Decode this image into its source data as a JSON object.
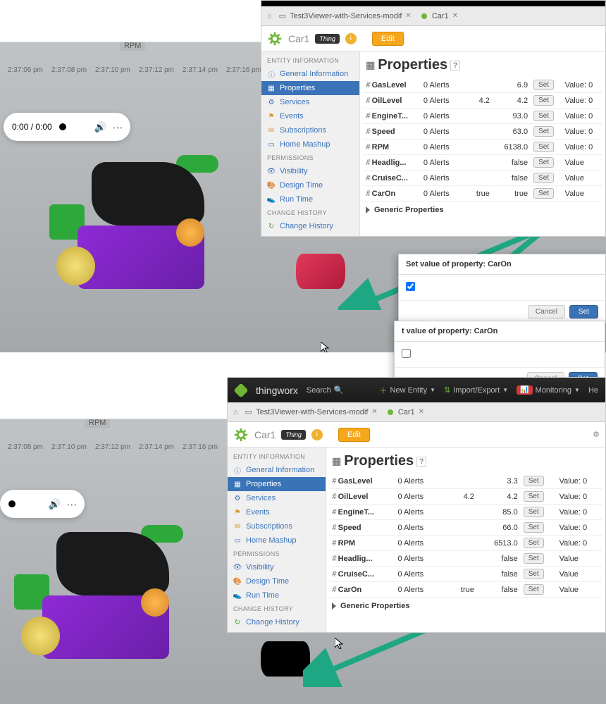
{
  "upper": {
    "home_title": "Home",
    "rpm_label": "RPM",
    "timeline": [
      "2:37:06 pm",
      "2:37:08 pm",
      "2:37:10 pm",
      "2:37:12 pm",
      "2:37:14 pm",
      "2:37:16 pm"
    ],
    "media_time": "0:00 / 0:00",
    "panel": {
      "tabs": [
        {
          "icon": "doc",
          "label": "Test3Viewer-with-Services-modif"
        },
        {
          "icon": "car",
          "label": "Car1"
        }
      ],
      "entity_name": "Car1",
      "thing_label": "Thing",
      "edit_label": "Edit",
      "main_title": "Properties",
      "side_head1": "ENTITY INFORMATION",
      "side_items1": [
        {
          "ico": "ℹ",
          "label": "General Information"
        },
        {
          "ico": "▦",
          "label": "Properties",
          "active": true
        },
        {
          "ico": "⚙",
          "label": "Services"
        },
        {
          "ico": "⚑",
          "label": "Events"
        },
        {
          "ico": "✉",
          "label": "Subscriptions"
        },
        {
          "ico": "⌂",
          "label": "Home Mashup"
        }
      ],
      "side_head2": "PERMISSIONS",
      "side_items2": [
        {
          "ico": "👁",
          "label": "Visibility"
        },
        {
          "ico": "🎨",
          "label": "Design Time"
        },
        {
          "ico": "👟",
          "label": "Run Time"
        }
      ],
      "side_head3": "CHANGE HISTORY",
      "side_items3": [
        {
          "ico": "↻",
          "label": "Change History"
        }
      ],
      "props": [
        {
          "name": "GasLevel",
          "alerts": "0 Alerts",
          "c3": "",
          "c4": "6.9",
          "set": "Set",
          "val": "Value: 0"
        },
        {
          "name": "OilLevel",
          "alerts": "0 Alerts",
          "c3": "4.2",
          "c4": "4.2",
          "set": "Set",
          "val": "Value: 0"
        },
        {
          "name": "EngineT...",
          "alerts": "0 Alerts",
          "c3": "",
          "c4": "93.0",
          "set": "Set",
          "val": "Value: 0"
        },
        {
          "name": "Speed",
          "alerts": "0 Alerts",
          "c3": "",
          "c4": "63.0",
          "set": "Set",
          "val": "Value: 0"
        },
        {
          "name": "RPM",
          "alerts": "0 Alerts",
          "c3": "",
          "c4": "6138.0",
          "set": "Set",
          "val": "Value: 0"
        },
        {
          "name": "Headlig...",
          "alerts": "0 Alerts",
          "c3": "",
          "c4": "false",
          "set": "Set",
          "val": "Value"
        },
        {
          "name": "CruiseC...",
          "alerts": "0 Alerts",
          "c3": "",
          "c4": "false",
          "set": "Set",
          "val": "Value"
        },
        {
          "name": "CarOn",
          "alerts": "0 Alerts",
          "c3": "true",
          "c4": "true",
          "set": "Set",
          "val": "Value"
        }
      ],
      "generic": "Generic Properties"
    },
    "popup1": {
      "title": "Set value of property: CarOn",
      "checked": true,
      "cancel": "Cancel",
      "set": "Set"
    },
    "popup2": {
      "title": "t value of property: CarOn",
      "checked": false,
      "cancel": "Cancel",
      "set": "Set"
    }
  },
  "lower": {
    "topbar": {
      "brand": "thingworx",
      "search": "Search",
      "new_entity": "New Entity",
      "import": "Import/Export",
      "monitoring": "Monitoring",
      "help": "He"
    },
    "home_title": "Home",
    "rpm_label": "RPM",
    "timeline": [
      "2:37:08 pm",
      "2:37:10 pm",
      "2:37:12 pm",
      "2:37:14 pm",
      "2:37:16 pm"
    ],
    "panel": {
      "tabs": [
        {
          "icon": "doc",
          "label": "Test3Viewer-with-Services-modif"
        },
        {
          "icon": "car",
          "label": "Car1"
        }
      ],
      "entity_name": "Car1",
      "thing_label": "Thing",
      "edit_label": "Edit",
      "main_title": "Properties",
      "side_head1": "ENTITY INFORMATION",
      "side_items1": [
        {
          "ico": "ℹ",
          "label": "General Information"
        },
        {
          "ico": "▦",
          "label": "Properties",
          "active": true
        },
        {
          "ico": "⚙",
          "label": "Services"
        },
        {
          "ico": "⚑",
          "label": "Events"
        },
        {
          "ico": "✉",
          "label": "Subscriptions"
        },
        {
          "ico": "⌂",
          "label": "Home Mashup"
        }
      ],
      "side_head2": "PERMISSIONS",
      "side_items2": [
        {
          "ico": "👁",
          "label": "Visibility"
        },
        {
          "ico": "🎨",
          "label": "Design Time"
        },
        {
          "ico": "👟",
          "label": "Run Time"
        }
      ],
      "side_head3": "CHANGE HISTORY",
      "side_items3": [
        {
          "ico": "↻",
          "label": "Change History"
        }
      ],
      "props": [
        {
          "name": "GasLevel",
          "alerts": "0 Alerts",
          "c3": "",
          "c4": "3.3",
          "set": "Set",
          "val": "Value: 0"
        },
        {
          "name": "OilLevel",
          "alerts": "0 Alerts",
          "c3": "4.2",
          "c4": "4.2",
          "set": "Set",
          "val": "Value: 0"
        },
        {
          "name": "EngineT...",
          "alerts": "0 Alerts",
          "c3": "",
          "c4": "85.0",
          "set": "Set",
          "val": "Value: 0"
        },
        {
          "name": "Speed",
          "alerts": "0 Alerts",
          "c3": "",
          "c4": "66.0",
          "set": "Set",
          "val": "Value: 0"
        },
        {
          "name": "RPM",
          "alerts": "0 Alerts",
          "c3": "",
          "c4": "6513.0",
          "set": "Set",
          "val": "Value: 0"
        },
        {
          "name": "Headlig...",
          "alerts": "0 Alerts",
          "c3": "",
          "c4": "false",
          "set": "Set",
          "val": "Value"
        },
        {
          "name": "CruiseC...",
          "alerts": "0 Alerts",
          "c3": "",
          "c4": "false",
          "set": "Set",
          "val": "Value"
        },
        {
          "name": "CarOn",
          "alerts": "0 Alerts",
          "c3": "true",
          "c4": "false",
          "set": "Set",
          "val": "Value"
        }
      ],
      "generic": "Generic Properties"
    }
  }
}
